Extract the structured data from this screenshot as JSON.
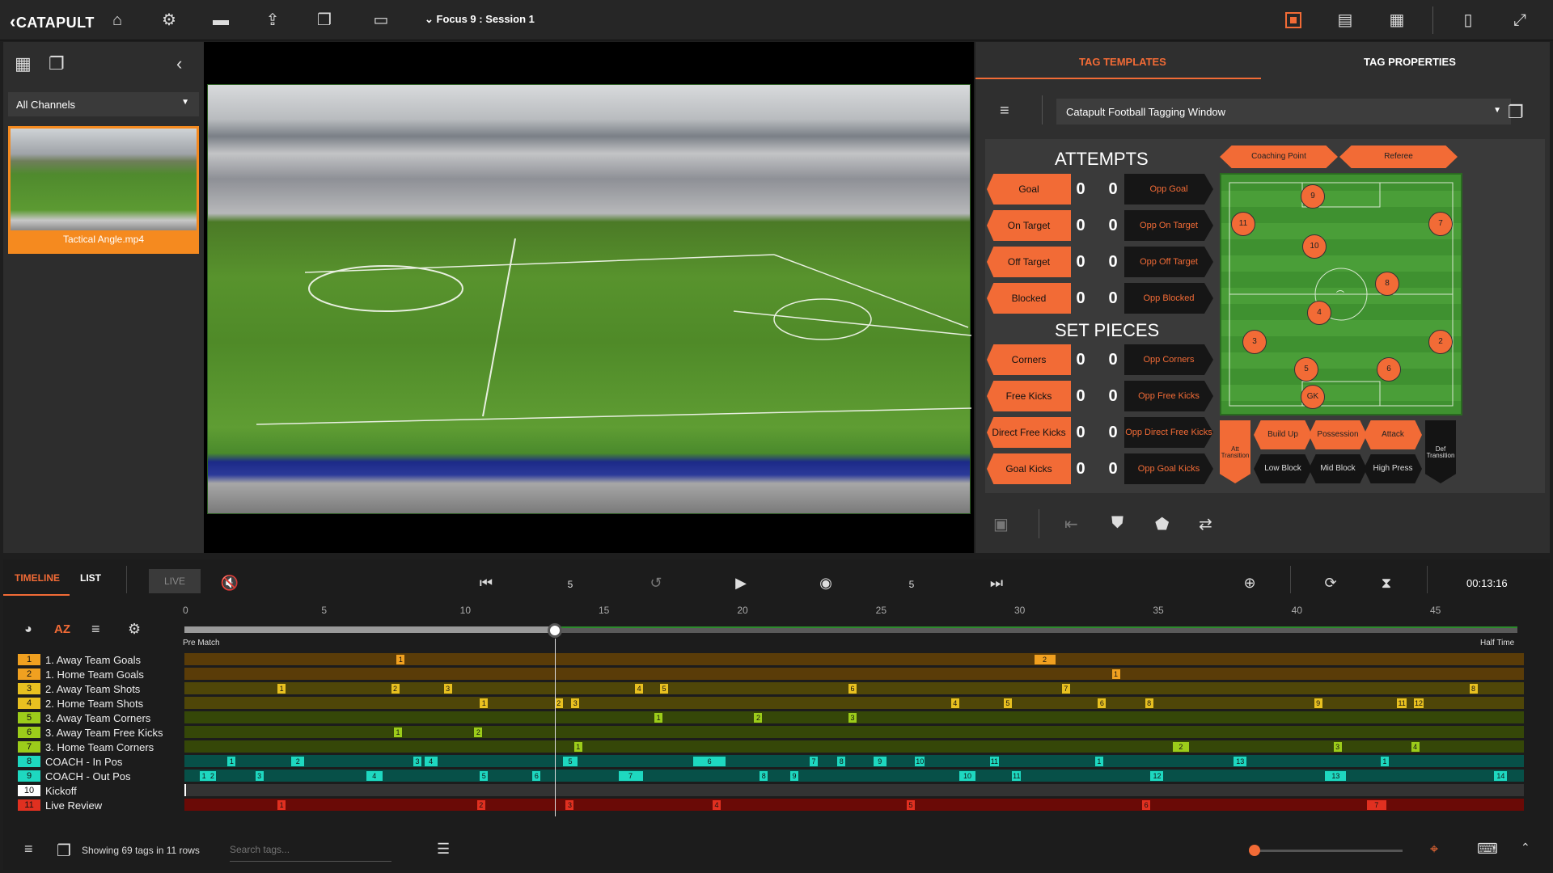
{
  "app": {
    "logo": "CATAPULT",
    "session": "Focus 9 : Session 1"
  },
  "topbar_icons": [
    "home-icon",
    "gear-icon",
    "clapperboard-icon",
    "upload-icon",
    "bookmarks-icon",
    "monitor-icon"
  ],
  "left": {
    "channel_select": "All Channels",
    "video_name": "Tactical Angle.mp4"
  },
  "tag_panel": {
    "tab_templates": "TAG TEMPLATES",
    "tab_properties": "TAG PROPERTIES",
    "template_select": "Catapult Football Tagging Window",
    "section_attempts": "ATTEMPTS",
    "section_setpieces": "SET PIECES",
    "attempts": [
      {
        "own": "Goal",
        "own_count": "0",
        "opp_count": "0",
        "opp": "Opp Goal"
      },
      {
        "own": "On Target",
        "own_count": "0",
        "opp_count": "0",
        "opp": "Opp On Target"
      },
      {
        "own": "Off Target",
        "own_count": "0",
        "opp_count": "0",
        "opp": "Opp Off Target"
      },
      {
        "own": "Blocked",
        "own_count": "0",
        "opp_count": "0",
        "opp": "Opp Blocked"
      }
    ],
    "setpieces": [
      {
        "own": "Corners",
        "own_count": "0",
        "opp_count": "0",
        "opp": "Opp Corners"
      },
      {
        "own": "Free Kicks",
        "own_count": "0",
        "opp_count": "0",
        "opp": "Opp Free Kicks"
      },
      {
        "own": "Direct Free Kicks",
        "own_count": "0",
        "opp_count": "0",
        "opp": "Opp Direct Free Kicks"
      },
      {
        "own": "Goal Kicks",
        "own_count": "0",
        "opp_count": "0",
        "opp": "Opp Goal Kicks"
      }
    ],
    "ribbons": {
      "coaching": "Coaching Point",
      "referee": "Referee"
    },
    "players": [
      "9",
      "11",
      "7",
      "10",
      "8",
      "4",
      "3",
      "2",
      "5",
      "6",
      "GK"
    ],
    "center_mark": "⌒",
    "phases": {
      "att_transition": "Att Transition",
      "build_up": "Build Up",
      "possession": "Possession",
      "attack": "Attack",
      "def_transition": "Def Transition",
      "low_block": "Low Block",
      "mid_block": "Mid Block",
      "high_press": "High Press"
    }
  },
  "bottom": {
    "tab_timeline": "TIMELINE",
    "tab_list": "LIST",
    "live": "LIVE",
    "rewind_label": "5",
    "forward_label": "5",
    "timecode": "00:13:16",
    "sort_label": "AZ",
    "ticks": [
      "0",
      "5",
      "10",
      "15",
      "20",
      "25",
      "30",
      "35",
      "40",
      "45"
    ],
    "pre_match": "Pre Match",
    "half_time": "Half Time",
    "showing": "Showing 69 tags in 11 rows",
    "search_placeholder": "Search tags..."
  },
  "rows": [
    {
      "n": "1",
      "label": "1. Away Team Goals",
      "color": "#f0a020",
      "track": "#5a3c08",
      "marks": [
        {
          "t": 7.6,
          "l": "1"
        },
        {
          "t": 30.6,
          "l": "2",
          "w": 26
        }
      ]
    },
    {
      "n": "2",
      "label": "1. Home Team Goals",
      "color": "#f0a020",
      "track": "#5a3c08",
      "marks": [
        {
          "t": 33.4,
          "l": "1"
        }
      ]
    },
    {
      "n": "3",
      "label": "2. Away Team Shots",
      "color": "#e8c020",
      "track": "#4f4608",
      "marks": [
        {
          "t": 3.3,
          "l": "1"
        },
        {
          "t": 7.4,
          "l": "2"
        },
        {
          "t": 9.3,
          "l": "3"
        },
        {
          "t": 16.2,
          "l": "4"
        },
        {
          "t": 17.1,
          "l": "5"
        },
        {
          "t": 23.9,
          "l": "6"
        },
        {
          "t": 31.6,
          "l": "7"
        },
        {
          "t": 46.3,
          "l": "8"
        }
      ]
    },
    {
      "n": "4",
      "label": "2. Home Team Shots",
      "color": "#e8c020",
      "track": "#4f4608",
      "marks": [
        {
          "t": 10.6,
          "l": "1"
        },
        {
          "t": 13.3,
          "l": "2"
        },
        {
          "t": 13.9,
          "l": "3"
        },
        {
          "t": 27.6,
          "l": "4"
        },
        {
          "t": 29.5,
          "l": "5"
        },
        {
          "t": 32.9,
          "l": "6"
        },
        {
          "t": 34.6,
          "l": "8"
        },
        {
          "t": 40.7,
          "l": "9"
        },
        {
          "t": 43.7,
          "l": "11"
        },
        {
          "t": 44.3,
          "l": "12"
        }
      ]
    },
    {
      "n": "5",
      "label": "3. Away Team Corners",
      "color": "#9ccc1a",
      "track": "#354708",
      "marks": [
        {
          "t": 16.9,
          "l": "1"
        },
        {
          "t": 20.5,
          "l": "2"
        },
        {
          "t": 23.9,
          "l": "3"
        }
      ]
    },
    {
      "n": "6",
      "label": "3. Away Team Free Kicks",
      "color": "#9ccc1a",
      "track": "#354708",
      "marks": [
        {
          "t": 7.5,
          "l": "1"
        },
        {
          "t": 10.4,
          "l": "2"
        }
      ]
    },
    {
      "n": "7",
      "label": "3. Home Team Corners",
      "color": "#9ccc1a",
      "track": "#354708",
      "marks": [
        {
          "t": 14.0,
          "l": "1"
        },
        {
          "t": 35.6,
          "l": "2",
          "w": 20
        },
        {
          "t": 41.4,
          "l": "3"
        },
        {
          "t": 44.2,
          "l": "4"
        }
      ]
    },
    {
      "n": "8",
      "label": "COACH - In Pos",
      "color": "#1ed8c0",
      "track": "#075048",
      "marks": [
        {
          "t": 1.5,
          "l": "1"
        },
        {
          "t": 3.8,
          "l": "2",
          "w": 16
        },
        {
          "t": 8.2,
          "l": "3"
        },
        {
          "t": 8.6,
          "l": "4",
          "w": 16
        },
        {
          "t": 13.6,
          "l": "5",
          "w": 18
        },
        {
          "t": 18.3,
          "l": "6",
          "w": 40
        },
        {
          "t": 22.5,
          "l": "7"
        },
        {
          "t": 23.5,
          "l": "8"
        },
        {
          "t": 24.8,
          "l": "9",
          "w": 16
        },
        {
          "t": 26.3,
          "l": "10"
        },
        {
          "t": 29.0,
          "l": "11"
        },
        {
          "t": 32.8,
          "l": "1"
        },
        {
          "t": 37.8,
          "l": "13",
          "w": 16
        },
        {
          "t": 43.1,
          "l": "1"
        }
      ]
    },
    {
      "n": "9",
      "label": "COACH - Out Pos",
      "color": "#1ed8c0",
      "track": "#075048",
      "marks": [
        {
          "t": 0.5,
          "l": "1"
        },
        {
          "t": 0.8,
          "l": "2"
        },
        {
          "t": 2.5,
          "l": "3"
        },
        {
          "t": 6.5,
          "l": "4",
          "w": 20
        },
        {
          "t": 10.6,
          "l": "5"
        },
        {
          "t": 12.5,
          "l": "6"
        },
        {
          "t": 15.6,
          "l": "7",
          "w": 30
        },
        {
          "t": 20.7,
          "l": "8"
        },
        {
          "t": 21.8,
          "l": "9"
        },
        {
          "t": 27.9,
          "l": "10",
          "w": 20
        },
        {
          "t": 29.8,
          "l": "11"
        },
        {
          "t": 34.8,
          "l": "12",
          "w": 16
        },
        {
          "t": 41.1,
          "l": "13",
          "w": 26
        },
        {
          "t": 47.2,
          "l": "14",
          "w": 16
        }
      ]
    },
    {
      "n": "10",
      "label": "Kickoff",
      "color": "#ffffff",
      "track": "#333333",
      "marks": []
    },
    {
      "n": "11",
      "label": "Live Review",
      "color": "#e03020",
      "track": "#6a0a06",
      "marks": [
        {
          "t": 3.3,
          "l": "1"
        },
        {
          "t": 10.5,
          "l": "2"
        },
        {
          "t": 13.7,
          "l": "3"
        },
        {
          "t": 19.0,
          "l": "4"
        },
        {
          "t": 26.0,
          "l": "5"
        },
        {
          "t": 34.5,
          "l": "6"
        },
        {
          "t": 42.6,
          "l": "7",
          "w": 24
        }
      ]
    }
  ],
  "playhead_minute": 13.3,
  "total_minutes": 48.5
}
